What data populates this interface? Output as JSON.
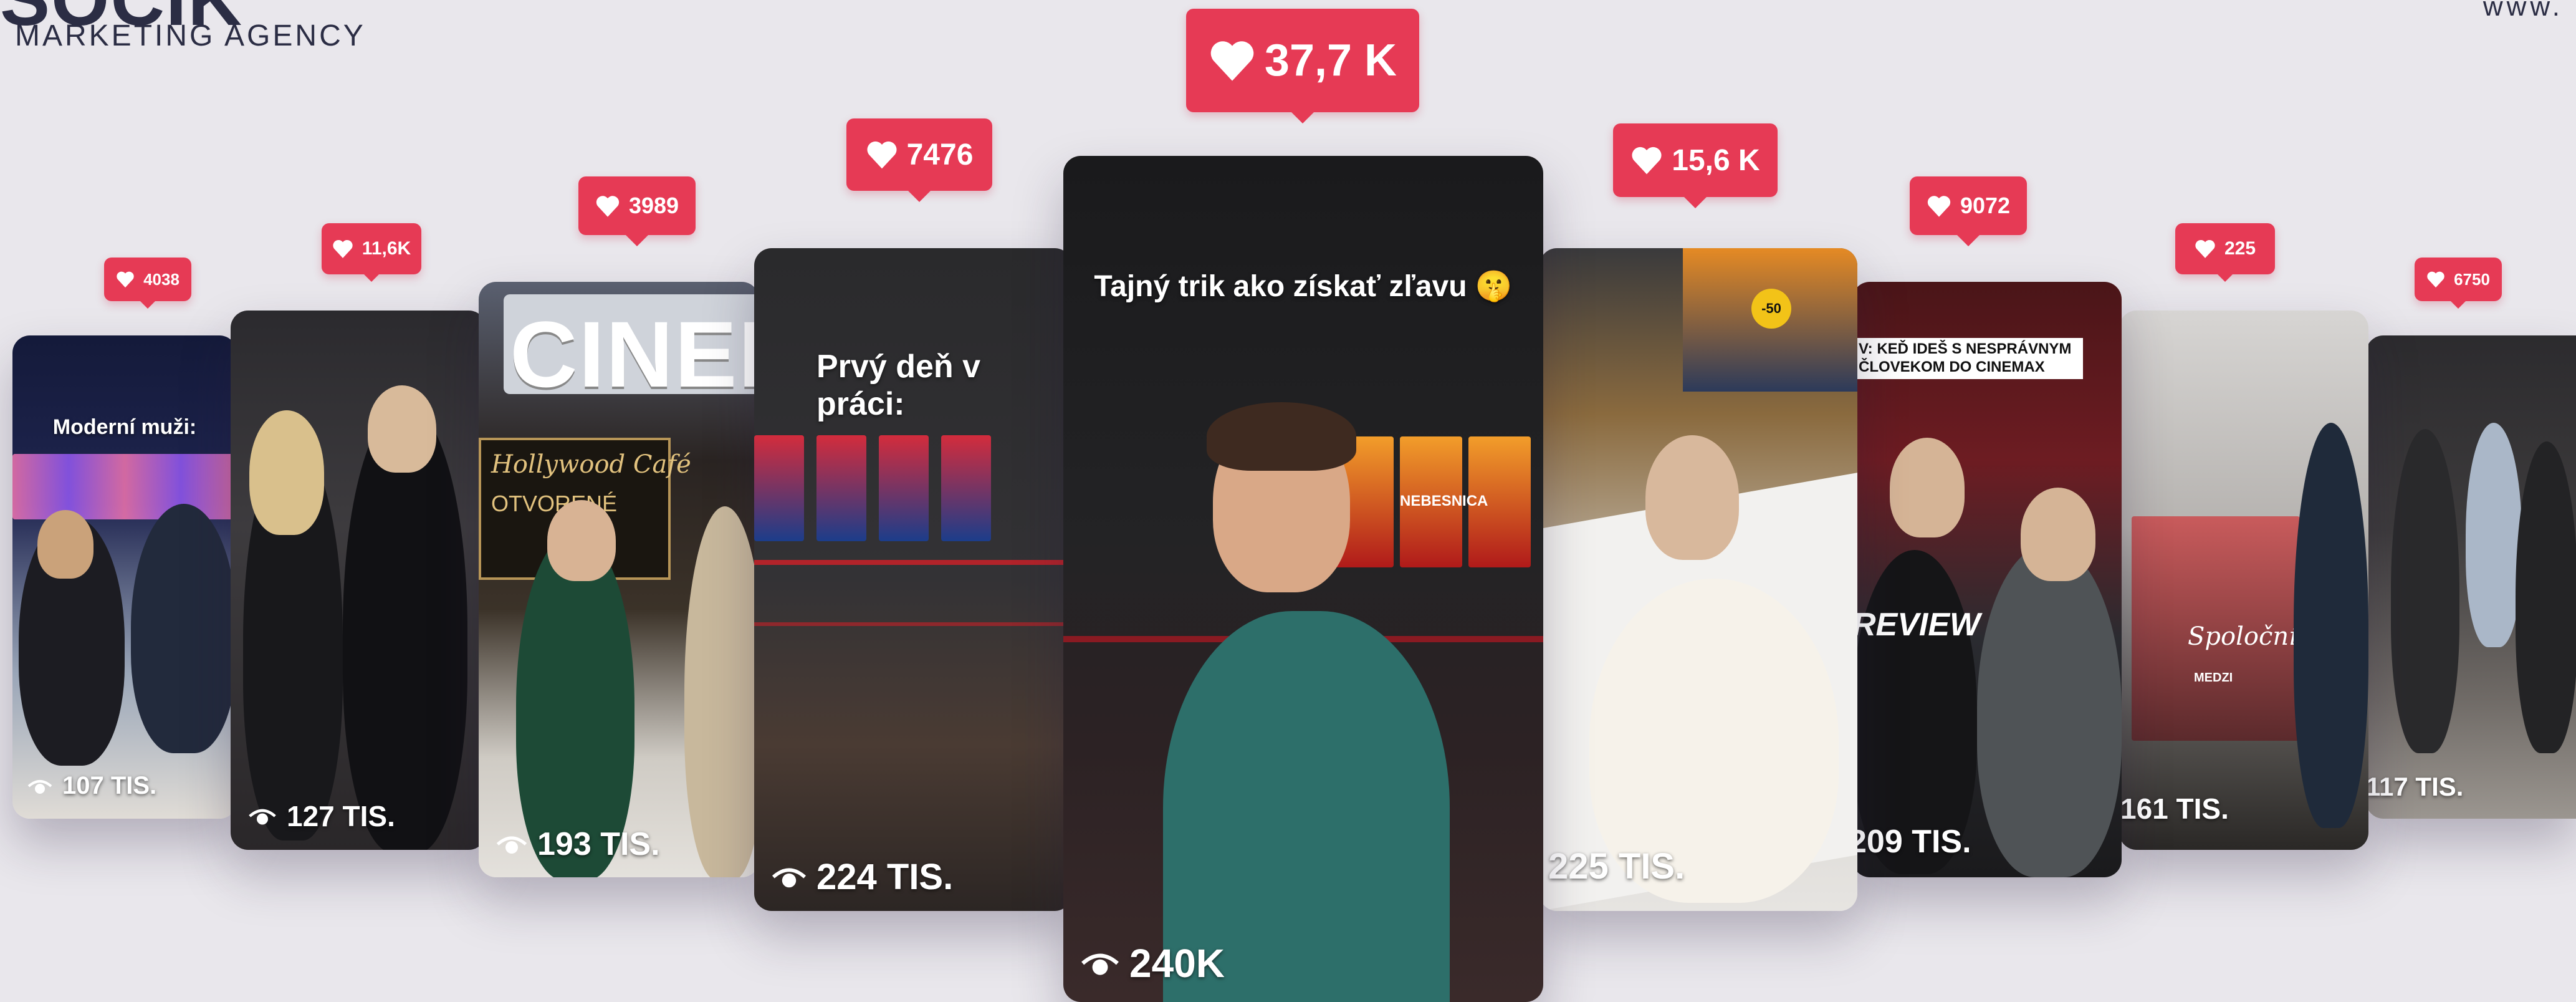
{
  "brand": {
    "name_fragment": "SOCIK",
    "tagline": "MARKETING AGENCY",
    "website_fragment": "www."
  },
  "videos": [
    {
      "id": "v1",
      "likes": "4038",
      "views": "107 TIS.",
      "caption": "Moderní muži:"
    },
    {
      "id": "v2",
      "likes": "11,6K",
      "views": "127 TIS.",
      "caption": ""
    },
    {
      "id": "v3",
      "likes": "3989",
      "views": "193 TIS.",
      "caption": "",
      "sign": "CINEM",
      "cafe": "Hollywood Café",
      "cafe_sub": "OTVORENÉ"
    },
    {
      "id": "v4",
      "likes": "7476",
      "views": "224 TIS.",
      "caption": "Prvý deň v práci:"
    },
    {
      "id": "v5",
      "likes": "37,7 K",
      "views": "240K",
      "caption": "Tajný trik ako získať zľavu 🤫",
      "poster_text": "NEBESNICA"
    },
    {
      "id": "v6",
      "likes": "15,6 K",
      "views": "225 TIS.",
      "caption": "",
      "sticker": "-50"
    },
    {
      "id": "v7",
      "likes": "9072",
      "views": "209 TIS.",
      "caption": "V: KEĎ IDEŠ S NESPRÁVNYM ČLOVEKOM DO CINEMAX",
      "shirt": "REVIEW"
    },
    {
      "id": "v8",
      "likes": "225",
      "views": "161 TIS.",
      "caption": "",
      "poster_title": "Spoločník",
      "poster_sub": "MEDZI"
    },
    {
      "id": "v9",
      "likes": "6750",
      "views": "117 TIS.",
      "caption": ""
    }
  ],
  "colors": {
    "badge": "#e63a55",
    "background": "#e9e7ec",
    "text_dark": "#2b2d44"
  },
  "icons": {
    "like": "heart-icon",
    "views": "eye-icon"
  }
}
